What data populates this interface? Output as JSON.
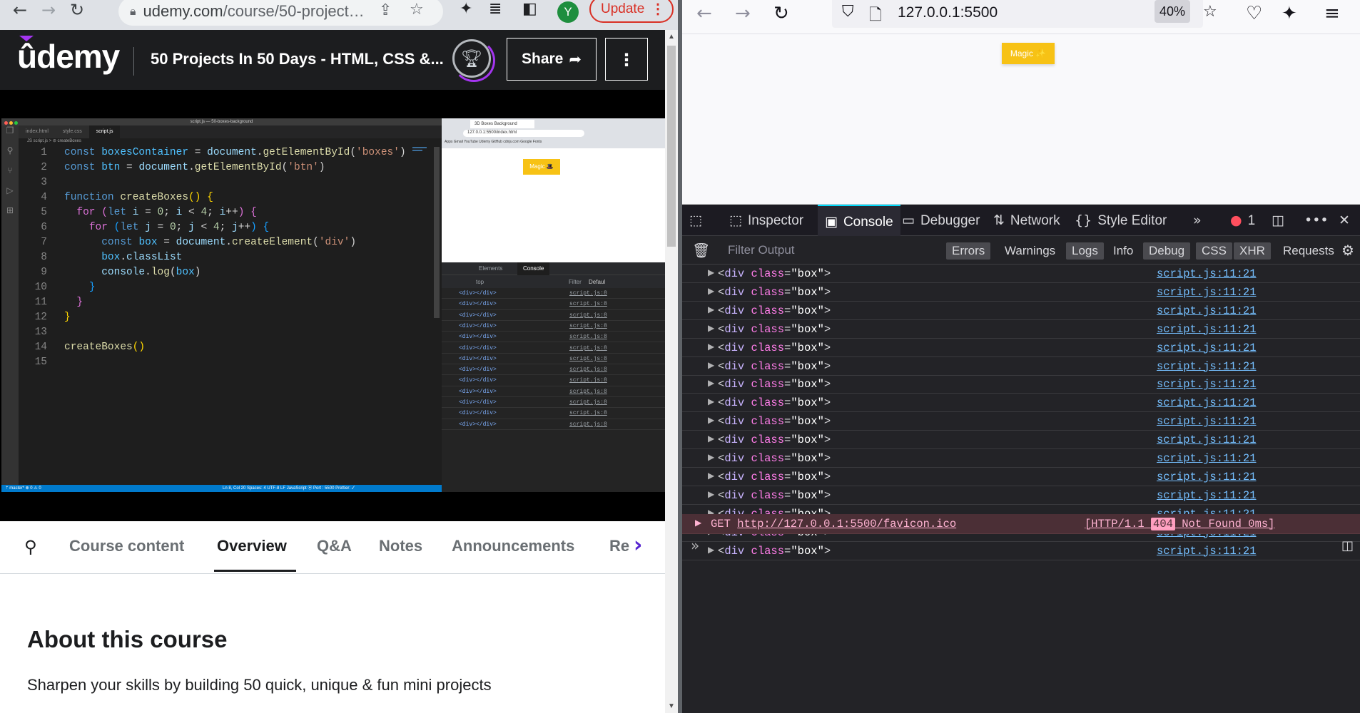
{
  "chrome": {
    "url_host": "udemy.com",
    "url_path": "/course/50-project…",
    "profile_initial": "Y",
    "update_label": "Update",
    "update_dots": "⋮"
  },
  "udemy": {
    "logo": "ûdemy",
    "course_title": "50 Projects In 50 Days - HTML, CSS &...",
    "share_label": "Share",
    "more_icon": "⋮"
  },
  "vscode": {
    "window_title": "script.js — 50-boxes-background",
    "tabs": [
      "index.html",
      "style.css",
      "script.js"
    ],
    "breadcrumb": "JS script.js > ⊘ createBoxes",
    "status_left": "ᛘ master*   ⊗ 0 ⚠ 0",
    "status_right": "Ln 8, Col 20   Spaces: 4   UTF-8   LF   JavaScript   ⦿ Port : 5500   Prettier: ✓"
  },
  "embedded_browser": {
    "tab_title": "3D Boxes Background",
    "address": "127.0.0.1:5500/index.html",
    "bookmarks": "Apps  Gmail  YouTube  Udemy  GitHub  cdnjs.com  Google Fonts",
    "magic_label": "Magic 🎩",
    "devtools_tabs": [
      "Elements",
      "Console"
    ],
    "context": "top",
    "filter": "Filter",
    "level": "Defaul",
    "log_entry": "<div></div>",
    "log_source": "script.js:8",
    "watermark": "udemy"
  },
  "course_tabs": {
    "items": [
      "Course content",
      "Overview",
      "Q&A",
      "Notes",
      "Announcements",
      "Re"
    ],
    "active": "Overview"
  },
  "about": {
    "heading": "About this course",
    "description": "Sharpen your skills by building 50 quick, unique & fun mini projects"
  },
  "firefox": {
    "url": "127.0.0.1:5500",
    "zoom": "40%",
    "magic_label": "Magic ✨"
  },
  "devtools": {
    "tabs": [
      "Inspector",
      "Console",
      "Debugger",
      "Network",
      "Style Editor"
    ],
    "active_tab": "Console",
    "error_count": "1",
    "filter_placeholder": "Filter Output",
    "filter_buttons": [
      "Errors",
      "Warnings",
      "Logs",
      "Info",
      "Debug",
      "CSS",
      "XHR",
      "Requests"
    ],
    "log_entry": "<div class=\"box\">",
    "log_tag": "div",
    "log_attr": "class",
    "log_value": "\"box\"",
    "log_source": "script.js:11:21",
    "error_method": "GET",
    "error_url": "http://127.0.0.1:5500/favicon.ico",
    "error_protocol": "[HTTP/1.1",
    "error_status": "404",
    "error_text": "Not Found 0ms]"
  }
}
